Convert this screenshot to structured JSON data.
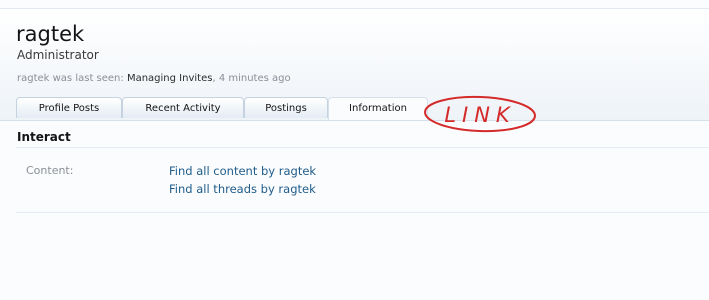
{
  "profile": {
    "username": "ragtek",
    "title": "Administrator",
    "last_seen_prefix": "ragtek was last seen:",
    "last_seen_activity": "Managing Invites",
    "last_seen_sep": ",",
    "last_seen_time": "4 minutes ago"
  },
  "tabs": [
    {
      "label": "Profile Posts",
      "active": false
    },
    {
      "label": "Recent Activity",
      "active": false
    },
    {
      "label": "Postings",
      "active": false
    },
    {
      "label": "Information",
      "active": true
    }
  ],
  "annotation": {
    "text": "LINK",
    "color": "#d42a2a"
  },
  "interact": {
    "title": "Interact",
    "content_label": "Content:",
    "links": [
      "Find all content by ragtek",
      "Find all threads by ragtek"
    ]
  },
  "colors": {
    "link": "#1f5c8a",
    "muted": "#8a8f96",
    "tab_border": "#c5d2df"
  }
}
